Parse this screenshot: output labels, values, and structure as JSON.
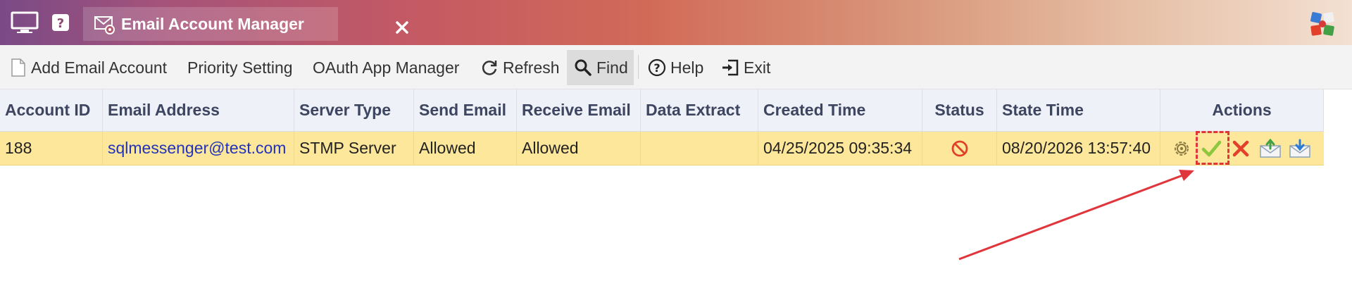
{
  "titlebar": {
    "tab_title": "Email Account Manager",
    "icons": [
      "monitor-icon",
      "help-icon",
      "mail-settings-icon",
      "close-icon",
      "app-logo-icon"
    ]
  },
  "toolbar": {
    "add_email_account": "Add Email Account",
    "priority_setting": "Priority Setting",
    "oauth_app_manager": "OAuth App Manager",
    "refresh": "Refresh",
    "find": "Find",
    "help": "Help",
    "exit": "Exit"
  },
  "table": {
    "headers": {
      "account_id": "Account ID",
      "email_address": "Email Address",
      "server_type": "Server Type",
      "send_email": "Send Email",
      "receive_email": "Receive Email",
      "data_extract": "Data Extract",
      "created_time": "Created Time",
      "status": "Status",
      "state_time": "State Time",
      "actions": "Actions"
    },
    "rows": [
      {
        "account_id": "188",
        "email_address": "sqlmessenger@test.com",
        "server_type": "STMP Server",
        "send_email": "Allowed",
        "receive_email": "Allowed",
        "data_extract": "",
        "created_time": "04/25/2025 09:35:34",
        "status_icon": "disabled-icon",
        "state_time": "08/20/2026 13:57:40",
        "actions": [
          "settings-icon",
          "enable-check-icon",
          "disable-x-icon",
          "export-icon",
          "import-icon"
        ]
      }
    ]
  },
  "colors": {
    "selected_row": "#fde79a",
    "header_bg": "#eef1f8",
    "link": "#2233bb",
    "annotation": "#e0353a",
    "check_green": "#8dc63f",
    "x_red": "#e2402b"
  }
}
